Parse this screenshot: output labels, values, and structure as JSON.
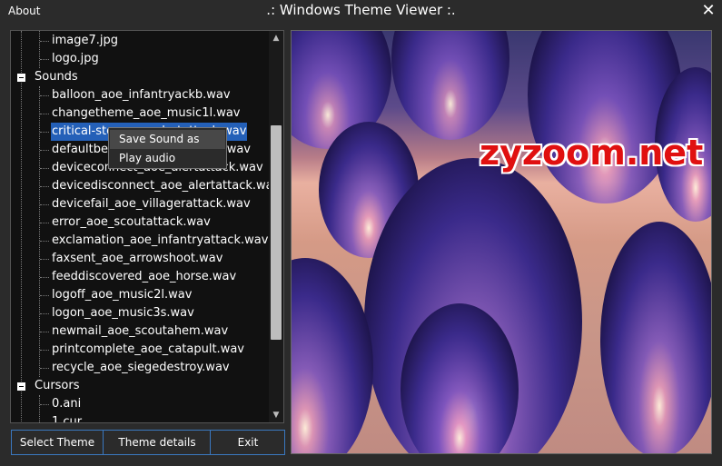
{
  "window": {
    "title": ".: Windows Theme Viewer :.",
    "about_label": "About",
    "close_symbol": "✕"
  },
  "tree": {
    "rows": [
      {
        "label": "image7.jpg",
        "kind": "file"
      },
      {
        "label": "logo.jpg",
        "kind": "file"
      },
      {
        "label": "Sounds",
        "kind": "group"
      },
      {
        "label": "balloon_aoe_infantryackb.wav",
        "kind": "file"
      },
      {
        "label": "changetheme_aoe_music1l.wav",
        "kind": "file"
      },
      {
        "label": "critical-stop_aoe_alertattack.wav",
        "kind": "file",
        "selected": true
      },
      {
        "label": "defaultbeep_aoe_infantryack.wav",
        "kind": "file"
      },
      {
        "label": "deviceconnect_aoe_alertattack.wav",
        "kind": "file"
      },
      {
        "label": "devicedisconnect_aoe_alertattack.wav",
        "kind": "file"
      },
      {
        "label": "devicefail_aoe_villagerattack.wav",
        "kind": "file"
      },
      {
        "label": "error_aoe_scoutattack.wav",
        "kind": "file"
      },
      {
        "label": "exclamation_aoe_infantryattack.wav",
        "kind": "file"
      },
      {
        "label": "faxsent_aoe_arrowshoot.wav",
        "kind": "file"
      },
      {
        "label": "feeddiscovered_aoe_horse.wav",
        "kind": "file"
      },
      {
        "label": "logoff_aoe_music2l.wav",
        "kind": "file"
      },
      {
        "label": "logon_aoe_music3s.wav",
        "kind": "file"
      },
      {
        "label": "newmail_aoe_scoutahem.wav",
        "kind": "file"
      },
      {
        "label": "printcomplete_aoe_catapult.wav",
        "kind": "file"
      },
      {
        "label": "recycle_aoe_siegedestroy.wav",
        "kind": "file"
      },
      {
        "label": "Cursors",
        "kind": "group"
      },
      {
        "label": "0.ani",
        "kind": "file"
      },
      {
        "label": "1.cur",
        "kind": "file"
      }
    ]
  },
  "context_menu": {
    "items": [
      {
        "label": "Save Sound as",
        "highlighted": true
      },
      {
        "label": "Play audio",
        "highlighted": false
      }
    ]
  },
  "buttons": {
    "select_theme": "Select Theme",
    "theme_details": "Theme details",
    "exit": "Exit"
  },
  "preview": {
    "watermark": "zyzoom.net"
  },
  "colors": {
    "background": "#2b2b2b",
    "selection": "#2460b8",
    "button_border": "#3a78c0",
    "watermark": "#e01010"
  }
}
